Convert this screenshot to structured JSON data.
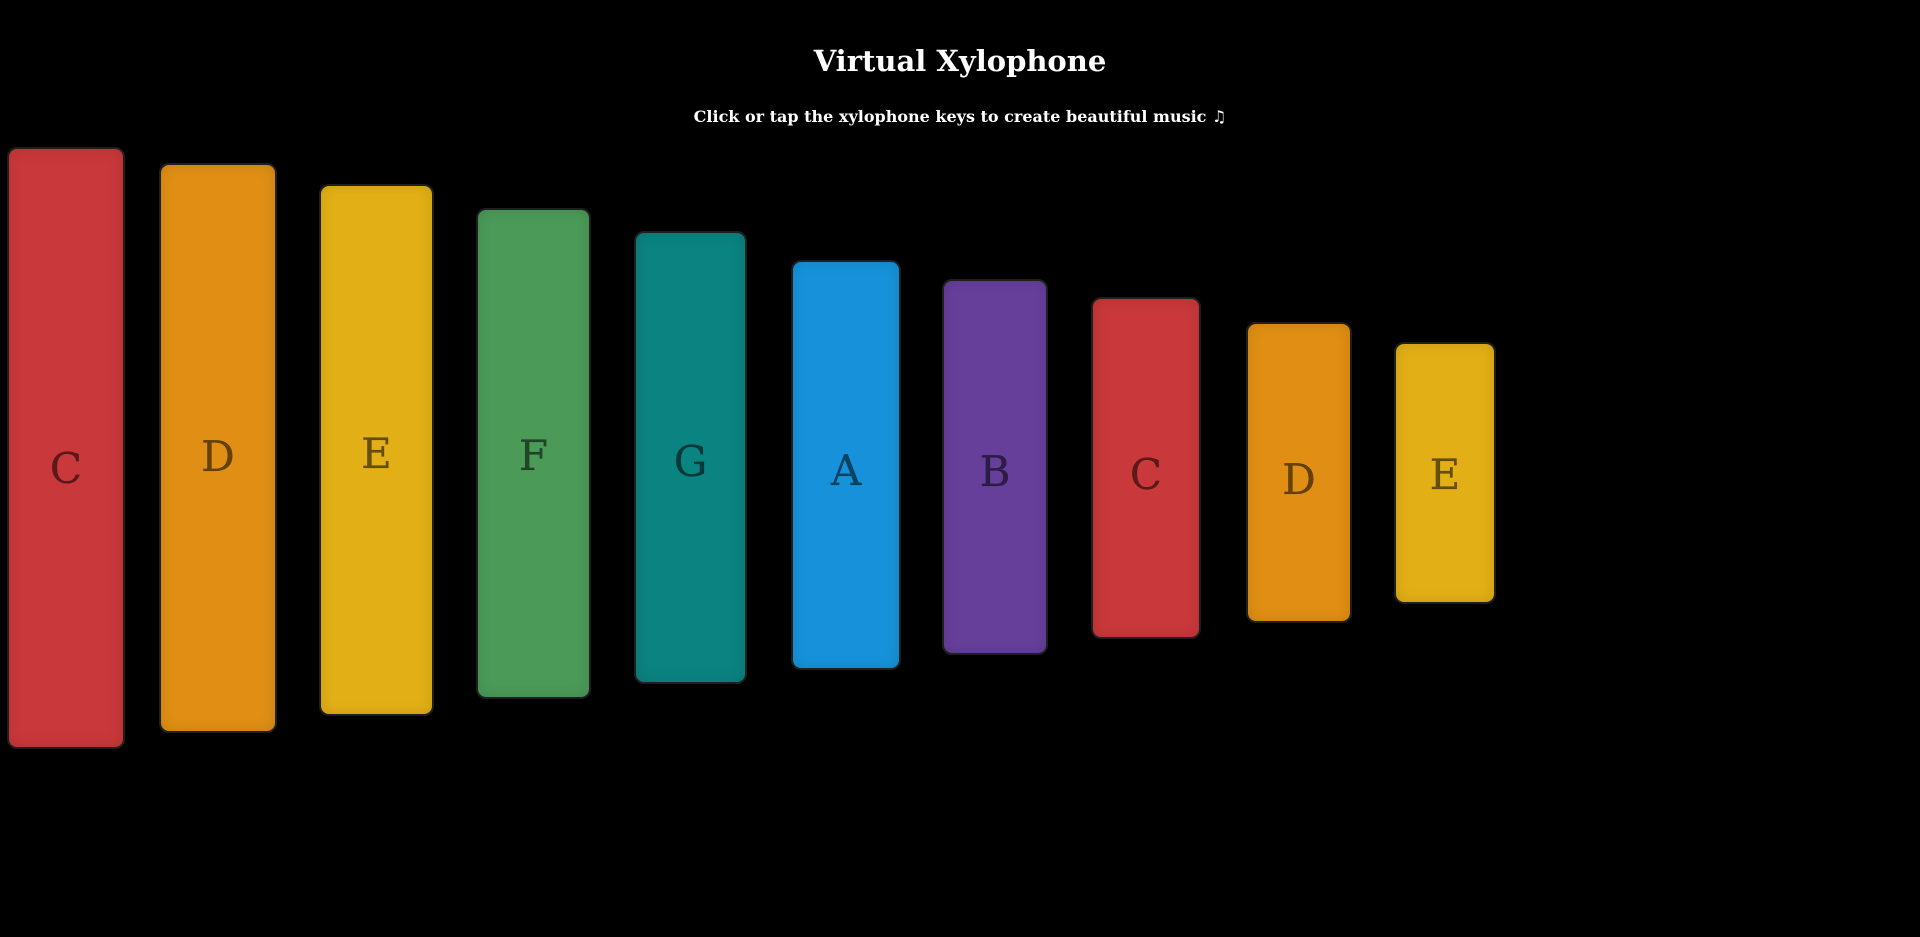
{
  "header": {
    "title": "Virtual Xylophone",
    "subtitle": "Click or tap the xylophone keys to create beautiful music ♫"
  },
  "keys": [
    {
      "note": "C",
      "color": "#c9383a"
    },
    {
      "note": "D",
      "color": "#e08f14"
    },
    {
      "note": "E",
      "color": "#e2b016"
    },
    {
      "note": "F",
      "color": "#4b9a58"
    },
    {
      "note": "G",
      "color": "#0b8380"
    },
    {
      "note": "A",
      "color": "#1792da"
    },
    {
      "note": "B",
      "color": "#663f9b"
    },
    {
      "note": "C",
      "color": "#c9383a"
    },
    {
      "note": "D",
      "color": "#e08f14"
    },
    {
      "note": "E",
      "color": "#e2b016"
    }
  ]
}
